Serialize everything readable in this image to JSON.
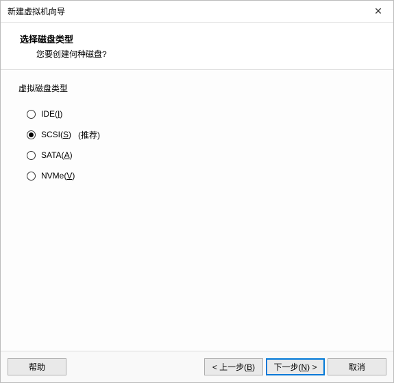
{
  "window": {
    "title": "新建虚拟机向导",
    "close_glyph": "✕"
  },
  "header": {
    "heading": "选择磁盘类型",
    "subheading": "您要创建何种磁盘?"
  },
  "group": {
    "label": "虚拟磁盘类型"
  },
  "options": [
    {
      "prefix": "IDE(",
      "mnemonic": "I",
      "suffix": ")",
      "checked": false,
      "hint": ""
    },
    {
      "prefix": "SCSI(",
      "mnemonic": "S",
      "suffix": ")",
      "checked": true,
      "hint": "(推荐)"
    },
    {
      "prefix": "SATA(",
      "mnemonic": "A",
      "suffix": ")",
      "checked": false,
      "hint": ""
    },
    {
      "prefix": "NVMe(",
      "mnemonic": "V",
      "suffix": ")",
      "checked": false,
      "hint": ""
    }
  ],
  "buttons": {
    "help": "帮助",
    "back_prefix": "< 上一步(",
    "back_mn": "B",
    "back_suffix": ")",
    "next_prefix": "下一步(",
    "next_mn": "N",
    "next_suffix": ") >",
    "cancel": "取消"
  }
}
